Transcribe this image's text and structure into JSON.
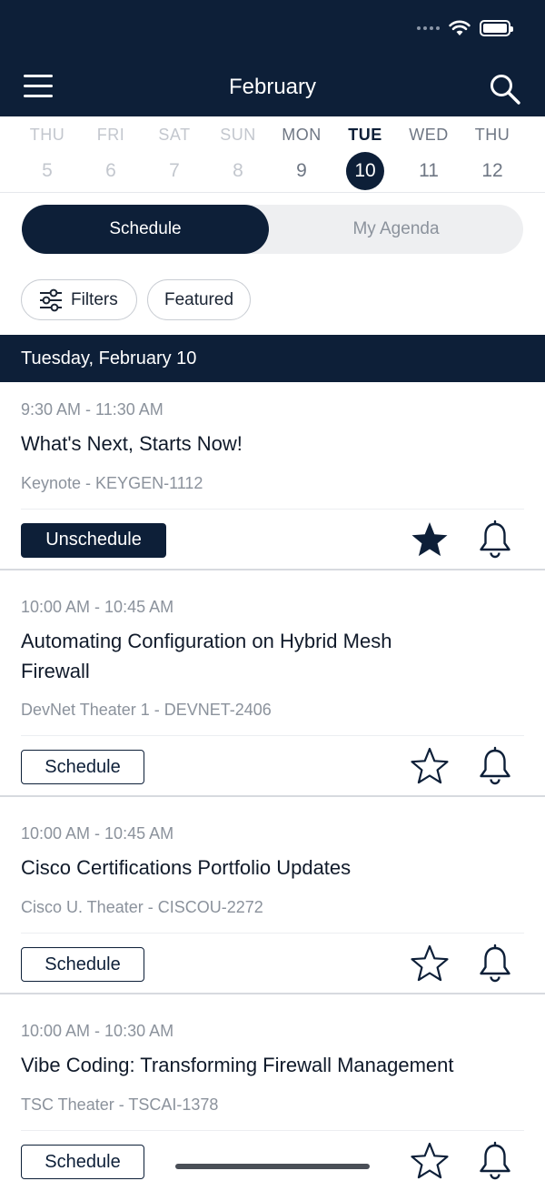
{
  "header": {
    "title": "February"
  },
  "week": [
    {
      "dow": "THU",
      "num": "5",
      "state": "past"
    },
    {
      "dow": "FRI",
      "num": "6",
      "state": "past"
    },
    {
      "dow": "SAT",
      "num": "7",
      "state": "past"
    },
    {
      "dow": "SUN",
      "num": "8",
      "state": "past"
    },
    {
      "dow": "MON",
      "num": "9",
      "state": "active"
    },
    {
      "dow": "TUE",
      "num": "10",
      "state": "selected"
    },
    {
      "dow": "WED",
      "num": "11",
      "state": "active"
    },
    {
      "dow": "THU",
      "num": "12",
      "state": "active"
    }
  ],
  "tabs": {
    "schedule": "Schedule",
    "agenda": "My Agenda"
  },
  "chips": {
    "filters": "Filters",
    "featured": "Featured"
  },
  "date_header": "Tuesday, February 10",
  "sessions": [
    {
      "time": "9:30 AM - 11:30 AM",
      "title": "What's Next, Starts Now!",
      "meta": "Keynote - KEYGEN-1112",
      "button": "Unschedule",
      "scheduled": true
    },
    {
      "time": "10:00 AM - 10:45 AM",
      "title": "Automating Configuration on Hybrid Mesh Firewall",
      "meta": "DevNet Theater 1 - DEVNET-2406",
      "button": "Schedule",
      "scheduled": false
    },
    {
      "time": "10:00 AM - 10:45 AM",
      "title": "Cisco Certifications Portfolio Updates",
      "meta": "Cisco U. Theater - CISCOU-2272",
      "button": "Schedule",
      "scheduled": false
    },
    {
      "time": "10:00 AM - 10:30 AM",
      "title": "Vibe Coding: Transforming Firewall Management",
      "meta": "TSC Theater - TSCAI-1378",
      "button": "Schedule",
      "scheduled": false
    }
  ],
  "colors": {
    "navy": "#0d1f38",
    "muted": "#8b929c"
  }
}
